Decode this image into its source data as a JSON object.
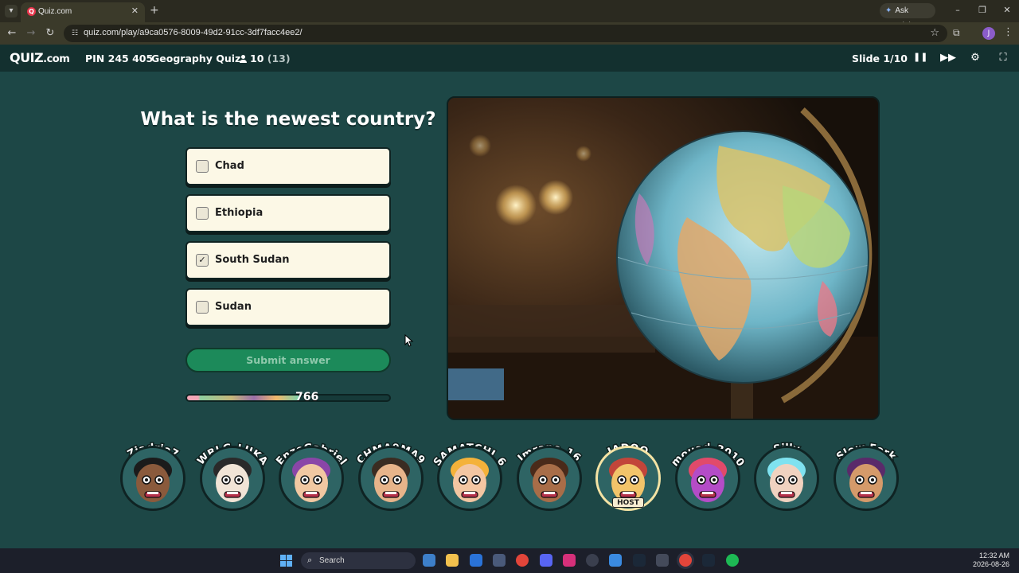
{
  "browser": {
    "tab_title": "Quiz.com",
    "url": "quiz.com/play/a9ca0576-8009-49d2-91cc-3df7facc4ee2/",
    "ask_gemini": "Ask Gemini",
    "profile_initial": "J"
  },
  "quiz": {
    "logo_main": "QUIZ",
    "logo_dot": ".com",
    "pin": "PIN 245 405",
    "title": "Geography Quiz",
    "players_count": "10",
    "players_total": "(13)",
    "slide": "Slide 1/10"
  },
  "question": {
    "text": "What is the newest country?",
    "answers": [
      {
        "label": "Chad",
        "checked": false
      },
      {
        "label": "Ethiopia",
        "checked": false
      },
      {
        "label": "South Sudan",
        "checked": true
      },
      {
        "label": "Sudan",
        "checked": false
      }
    ],
    "submit_label": "Submit answer",
    "score": "766",
    "score_fill_fraction": 0.55
  },
  "players": [
    {
      "name": "Ziadrio7",
      "skin": "#8a5a3c",
      "hair": "#1b1b1b",
      "host": false
    },
    {
      "name": "WBLG_LUKA",
      "skin": "#f1e4d6",
      "hair": "#2a2a2a",
      "host": false
    },
    {
      "name": "EnzoGabriel",
      "skin": "#f1c8a2",
      "hair": "#8a46a8",
      "host": false
    },
    {
      "name": "CHMA9MA9",
      "skin": "#e7b48a",
      "hair": "#3a2c22",
      "host": false
    },
    {
      "name": "SAMATCHI_6",
      "skin": "#f3c6a2",
      "hair": "#f4b23a",
      "host": false
    },
    {
      "name": "Imrane_16",
      "skin": "#a86d48",
      "hair": "#4a2a1a",
      "host": false
    },
    {
      "name": "JADOO",
      "skin": "#f2c46a",
      "hair": "#c2453a",
      "host": true
    },
    {
      "name": "mouad_3010",
      "skin": "#b44cc7",
      "hair": "#e14a6a",
      "host": false
    },
    {
      "name": "Silly",
      "skin": "#f0d2c0",
      "hair": "#7fe2f0",
      "host": false
    },
    {
      "name": "Slow Fork",
      "skin": "#d59a6a",
      "hair": "#5a2a6a",
      "host": false
    }
  ],
  "host_badge": "HOST",
  "taskbar": {
    "search_placeholder": "Search",
    "time": "12:32 AM",
    "date": "2026-08-26"
  },
  "colors": {
    "background": "#1d4746",
    "answer_bg": "#fcf8e6",
    "submit_bg": "#1c8a5a",
    "header_bg": "#13302f"
  }
}
